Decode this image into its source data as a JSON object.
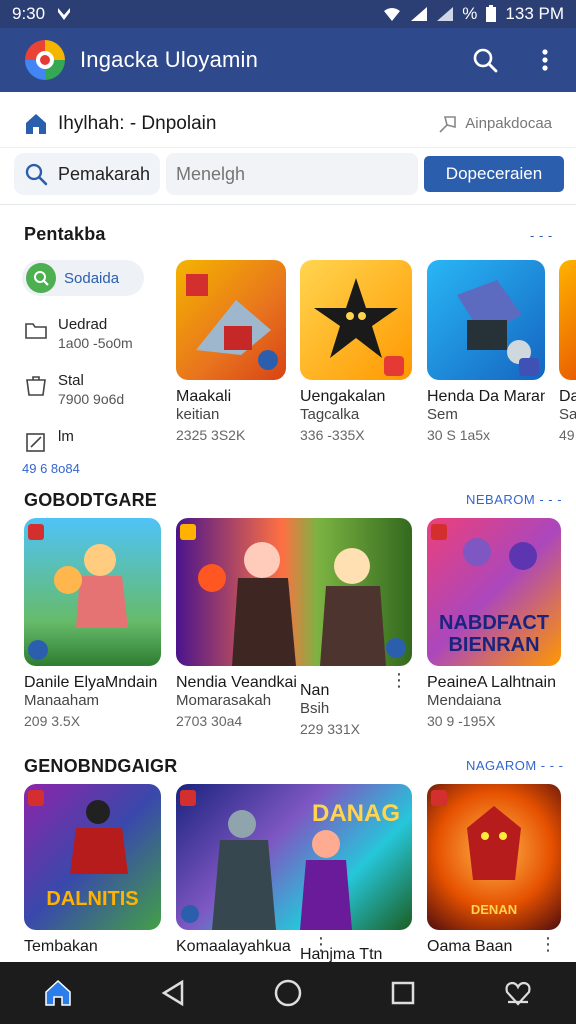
{
  "status_bar": {
    "time": "9:30",
    "battery_text": "133 PM",
    "signal_text": "%"
  },
  "app_bar": {
    "title": "Ingacka Uloyamin"
  },
  "breadcrumb": {
    "text": "Ihylhah: - Dnpolain",
    "right_label": "Ainpakdocaa"
  },
  "search": {
    "chip_label": "Pemakarah",
    "placeholder": "Menelgh",
    "button_label": "Dopeceraien"
  },
  "section1": {
    "title": "Pentakba",
    "filters": {
      "active": "Sodaida",
      "items": [
        {
          "label": "Uedrad",
          "sub": "1a00 -5o0m"
        },
        {
          "label": "Stal",
          "sub": "7900 9o6d"
        },
        {
          "label": "lm",
          "sub": ""
        }
      ],
      "extra": "49 6 8o84"
    },
    "cards": [
      {
        "name": "Maakali",
        "sub": "keitian",
        "meta": "2325 3S2K"
      },
      {
        "name": "Uengakalan",
        "sub": "Tagcalka",
        "meta": "336 -335X"
      },
      {
        "name": "Henda Da Maran",
        "sub": "Sem",
        "meta": "30 S 1a5x"
      },
      {
        "name": "Da",
        "sub": "Sa",
        "meta": "49"
      }
    ]
  },
  "section2": {
    "title": "GOBODTGARE",
    "more_label": "NEBAROM",
    "cards": [
      {
        "name": "Danile ElyaMndain",
        "sub": "Manaaham",
        "meta": "209 3.5X"
      },
      {
        "name": "Nendia Veandkai",
        "sub": "Momarasakah",
        "meta": "2703 30a4"
      },
      {
        "name": "Nan",
        "sub": "Bsih",
        "meta": "229 331X"
      },
      {
        "name": "PeaineA Lalhtnain",
        "sub": "Mendaiana",
        "meta": "30 9 -195X",
        "cover_text_1": "NABDFACT",
        "cover_text_2": "BIENRAN"
      }
    ]
  },
  "section3": {
    "title": "GENOBNDGAIGR",
    "more_label": "NAGAROM",
    "cards": [
      {
        "name": "Tembakan",
        "sub": "",
        "meta": "",
        "cover_text": "DALNITIS"
      },
      {
        "name": "Komaalayahkua",
        "sub": "",
        "meta": "",
        "cover_text": "DANAG"
      },
      {
        "name": "Hanjma Ttn",
        "sub": "",
        "meta": ""
      },
      {
        "name": "Oama Baan",
        "sub": "",
        "meta": "",
        "cover_text": "DENAN"
      }
    ]
  },
  "colors": {
    "app_bar": "#2f4a8c",
    "status_bar": "#2b3f75",
    "accent": "#2b5fae",
    "nav": "#1c1c1c"
  },
  "icons": [
    "logo-icon",
    "search-icon",
    "overflow-menu-icon",
    "home-icon",
    "share-icon",
    "back-icon",
    "circle-home-icon",
    "recents-icon",
    "favorite-icon"
  ]
}
